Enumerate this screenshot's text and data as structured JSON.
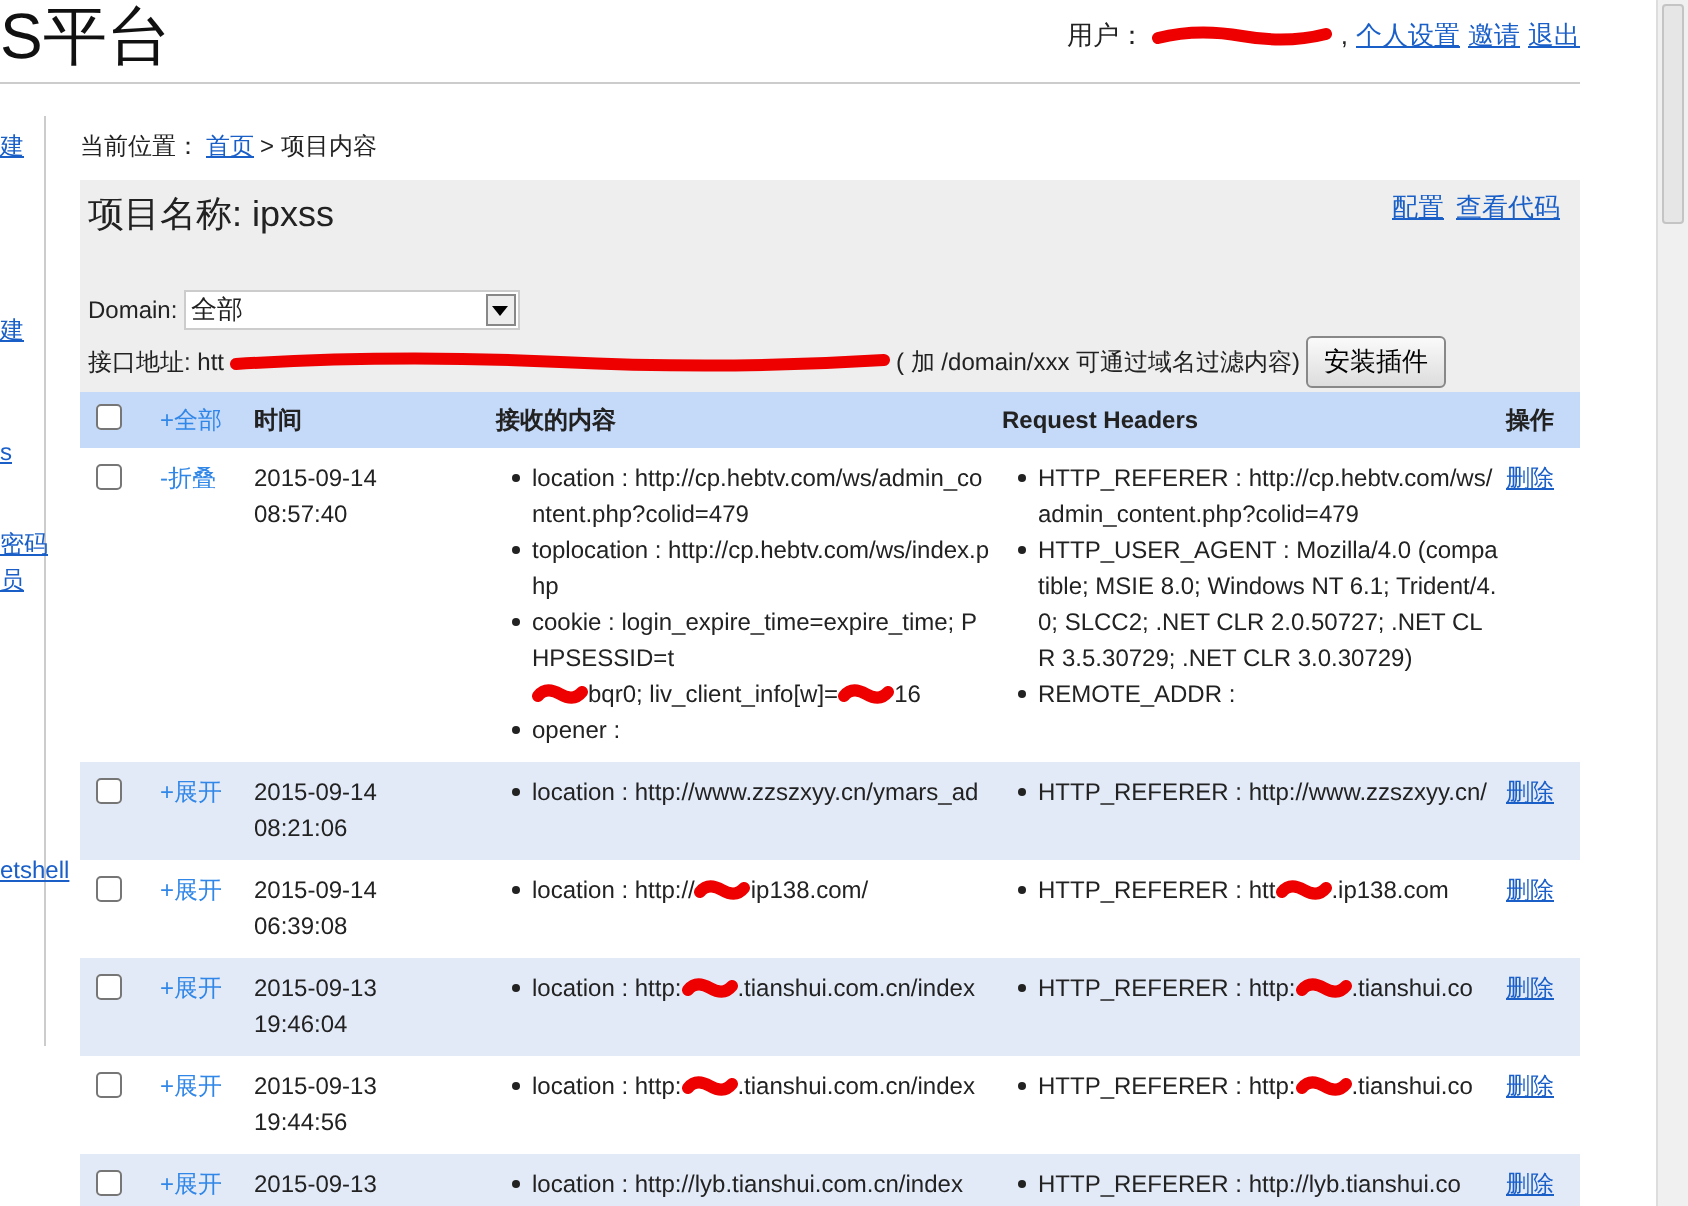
{
  "header": {
    "title": "S平台",
    "user": [
      "用户：",
      ","
    ],
    "links": [
      "个人设置",
      "邀请",
      "退出"
    ]
  },
  "sidebar": {
    "items": [
      "建",
      "建",
      "s",
      "密码",
      "员",
      "etshell"
    ]
  },
  "breadcrumb": {
    "label": "当前位置：",
    "home": "首页",
    "current": "> 项目内容"
  },
  "project": {
    "title": "项目名称: ipxss",
    "links": [
      "配置",
      "查看代码"
    ],
    "domain_label": "Domain:",
    "domain_value": "全部",
    "api": [
      "接口地址: htt",
      "( 加 /domain/xxx 可通过域名过滤内容)"
    ],
    "install_button": "安装插件"
  },
  "table": {
    "select_all": {
      "checked": false
    },
    "columns": [
      "+全部",
      "时间",
      "接收的内容",
      "Request Headers",
      "操作"
    ],
    "rows": [
      {
        "checked": false,
        "toggle": "-折叠",
        "time": "2015-09-14 08:57:40",
        "content": [
          [
            "location : http://cp.hebtv.com/ws/admin_content.php?colid=479"
          ],
          [
            "toplocation : http://cp.hebtv.com/ws/index.php"
          ],
          [
            "cookie : login_expire_time=expire_time; PHPSESSID=t",
            "bqr0; liv_client_info[w]=",
            "16"
          ],
          [
            "opener :"
          ]
        ],
        "headers": [
          [
            "HTTP_REFERER : http://cp.hebtv.com/ws/admin_content.php?colid=479"
          ],
          [
            "HTTP_USER_AGENT : Mozilla/4.0 (compatible; MSIE 8.0; Windows NT 6.1; Trident/4.0; SLCC2; .NET CLR 2.0.50727; .NET CLR 3.5.30729; .NET CLR 3.0.30729)"
          ],
          [
            "REMOTE_ADDR :"
          ]
        ],
        "action": "删除"
      },
      {
        "checked": false,
        "toggle": "+展开",
        "time": "2015-09-14 08:21:06",
        "content": [
          [
            "location : http://www.zzszxyy.cn/ymars_ad"
          ]
        ],
        "headers": [
          [
            "HTTP_REFERER : http://www.zzszxyy.cn/"
          ]
        ],
        "action": "删除"
      },
      {
        "checked": false,
        "toggle": "+展开",
        "time": "2015-09-14 06:39:08",
        "content": [
          [
            "location : http://",
            "ip138.com/"
          ]
        ],
        "headers": [
          [
            "HTTP_REFERER : htt",
            ".ip138.com"
          ]
        ],
        "action": "删除"
      },
      {
        "checked": false,
        "toggle": "+展开",
        "time": "2015-09-13 19:46:04",
        "content": [
          [
            "location : http:",
            ".tianshui.com.cn/index"
          ]
        ],
        "headers": [
          [
            "HTTP_REFERER : http:",
            ".tianshui.co"
          ]
        ],
        "action": "删除"
      },
      {
        "checked": false,
        "toggle": "+展开",
        "time": "2015-09-13 19:44:56",
        "content": [
          [
            "location : http:",
            ".tianshui.com.cn/index"
          ]
        ],
        "headers": [
          [
            "HTTP_REFERER : http:",
            ".tianshui.co"
          ]
        ],
        "action": "删除"
      },
      {
        "checked": false,
        "toggle": "+展开",
        "time": "2015-09-13",
        "content": [
          [
            "location : http://lyb.tianshui.com.cn/index"
          ]
        ],
        "headers": [
          [
            "HTTP_REFERER : http://lyb.tianshui.co"
          ]
        ],
        "action": "删除"
      }
    ]
  }
}
